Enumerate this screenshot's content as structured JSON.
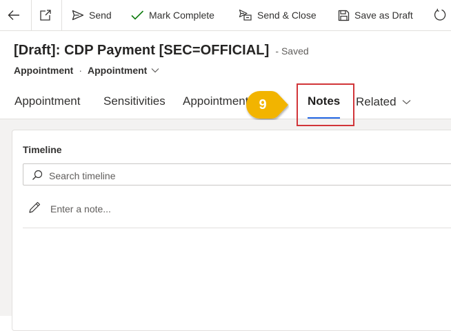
{
  "toolbar": {
    "send_label": "Send",
    "mark_complete_label": "Mark Complete",
    "send_close_label": "Send & Close",
    "save_draft_label": "Save as Draft"
  },
  "header": {
    "title": "[Draft]: CDP Payment [SEC=OFFICIAL]",
    "save_status": "- Saved",
    "entity_type": "Appointment",
    "separator": "·",
    "form_selector": "Appointment"
  },
  "tabs": [
    {
      "label": "Appointment"
    },
    {
      "label": "Sensitivities"
    },
    {
      "label": "Appointment Notes"
    },
    {
      "label": "Notes",
      "active": true
    },
    {
      "label": "Related"
    }
  ],
  "annotation": {
    "step_number": "9",
    "callout_color": "#F2B400",
    "highlight_color": "#D13438"
  },
  "timeline": {
    "label": "Timeline",
    "search_placeholder": "Search timeline",
    "note_placeholder": "Enter a note..."
  },
  "colors": {
    "accent": "#2266E3",
    "icon_green": "#107C10"
  }
}
